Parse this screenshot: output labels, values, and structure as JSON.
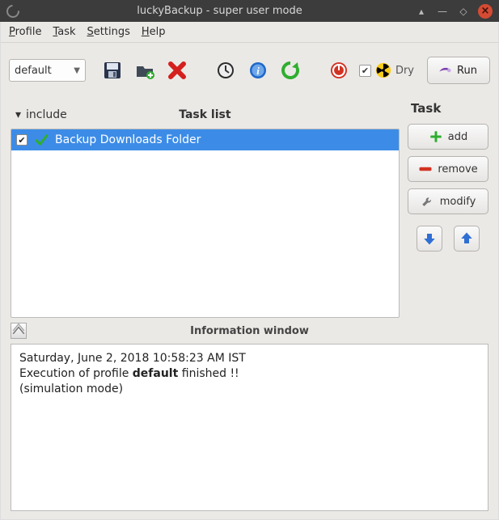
{
  "title": "luckyBackup - super user mode",
  "menu": {
    "profile": "Profile",
    "task": "Task",
    "settings": "Settings",
    "help": "Help"
  },
  "toolbar": {
    "profile_value": "default",
    "dry_label": "Dry",
    "run_label": "Run"
  },
  "taskpanel": {
    "include_label": "include",
    "list_title": "Task list",
    "task_section": "Task",
    "add_label": "add",
    "remove_label": "remove",
    "modify_label": "modify",
    "items": [
      {
        "label": "Backup Downloads Folder",
        "checked": true
      }
    ]
  },
  "infowin": {
    "title": "Information window",
    "timestamp_line": "Saturday, June 2, 2018 10:58:23 AM IST",
    "exec_pre": "Execution of profile ",
    "exec_profile": "default",
    "exec_post": " finished !!",
    "sim_line": "(simulation mode)"
  }
}
